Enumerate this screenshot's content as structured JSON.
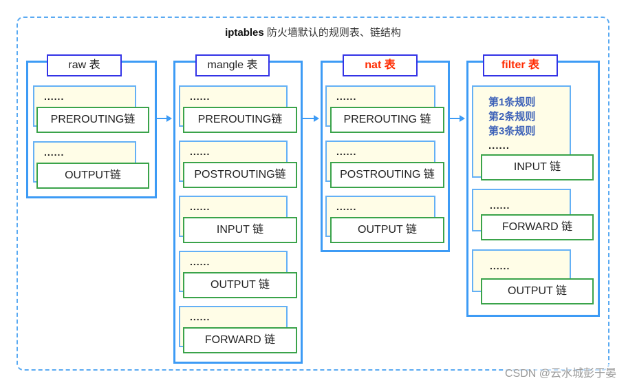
{
  "title": {
    "bold": "iptables",
    "rest": " 防火墙默认的规则表、链结构"
  },
  "tables": [
    {
      "name": "raw 表",
      "chains": [
        {
          "dots": "......",
          "label": "PREROUTING链"
        },
        {
          "dots": "......",
          "label": "OUTPUT链"
        }
      ]
    },
    {
      "name": "mangle 表",
      "chains": [
        {
          "dots": "......",
          "label": "PREROUTING链"
        },
        {
          "dots": "......",
          "label": "POSTROUTING链"
        },
        {
          "dots": "......",
          "label": "INPUT 链"
        },
        {
          "dots": "......",
          "label": "OUTPUT 链"
        },
        {
          "dots": "......",
          "label": "FORWARD 链"
        }
      ]
    },
    {
      "name": "nat 表",
      "chains": [
        {
          "dots": "......",
          "label": "PREROUTING 链"
        },
        {
          "dots": "......",
          "label": "POSTROUTING 链"
        },
        {
          "dots": "......",
          "label": "OUTPUT 链"
        }
      ]
    },
    {
      "name": "filter 表",
      "chains": [
        {
          "rules": [
            "第1条规则",
            "第2条规则",
            "第3条规则"
          ],
          "dots": "......",
          "label": "INPUT 链"
        },
        {
          "dots": "......",
          "label": "FORWARD 链"
        },
        {
          "dots": "......",
          "label": "OUTPUT 链"
        }
      ]
    }
  ],
  "colors": {
    "table_border": "#3d9bf5",
    "tab_border": "#3333e6",
    "chain_border": "#3aa34a",
    "rule_fill": "#fffde7",
    "highlight_text": "#ff2a00",
    "rule_text": "#3f63b8"
  },
  "watermark": "CSDN @云水城彭于晏"
}
